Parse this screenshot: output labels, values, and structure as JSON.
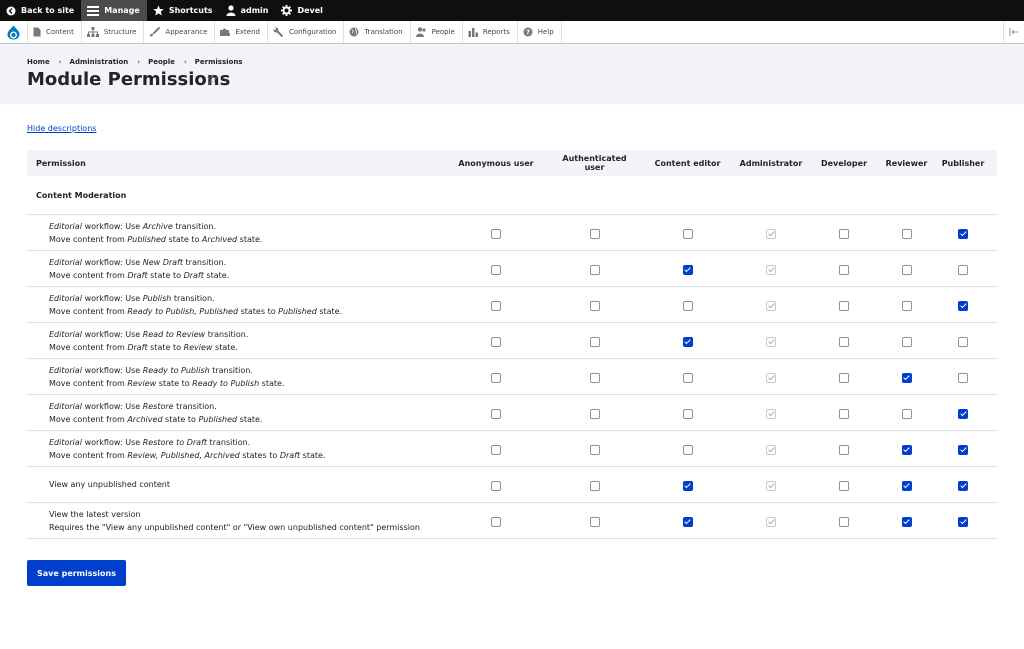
{
  "toolbar": {
    "back": "Back to site",
    "manage": "Manage",
    "shortcuts": "Shortcuts",
    "user": "admin",
    "devel": "Devel"
  },
  "tray": {
    "content": "Content",
    "structure": "Structure",
    "appearance": "Appearance",
    "extend": "Extend",
    "configuration": "Configuration",
    "translation": "Translation",
    "people": "People",
    "reports": "Reports",
    "help": "Help"
  },
  "breadcrumb": [
    "Home",
    "Administration",
    "People",
    "Permissions"
  ],
  "page_title": "Module Permissions",
  "hide_descriptions": "Hide descriptions",
  "columns": [
    "Permission",
    "Anonymous user",
    "Authenticated user",
    "Content editor",
    "Administrator",
    "Developer",
    "Reviewer",
    "Publisher"
  ],
  "group_title": "Content Moderation",
  "permissions": [
    {
      "line1": [
        {
          "t": "Editorial",
          "i": true
        },
        {
          "t": " workflow: Use "
        },
        {
          "t": "Archive",
          "i": true
        },
        {
          "t": " transition."
        }
      ],
      "line2": [
        {
          "t": "Move content from "
        },
        {
          "t": "Published",
          "i": true
        },
        {
          "t": " state to "
        },
        {
          "t": "Archived",
          "i": true
        },
        {
          "t": " state."
        }
      ],
      "checks": [
        0,
        0,
        0,
        2,
        0,
        0,
        1
      ]
    },
    {
      "line1": [
        {
          "t": "Editorial",
          "i": true
        },
        {
          "t": " workflow: Use "
        },
        {
          "t": "New Draft",
          "i": true
        },
        {
          "t": " transition."
        }
      ],
      "line2": [
        {
          "t": "Move content from "
        },
        {
          "t": "Draft",
          "i": true
        },
        {
          "t": " state to "
        },
        {
          "t": "Draft",
          "i": true
        },
        {
          "t": " state."
        }
      ],
      "checks": [
        0,
        0,
        1,
        2,
        0,
        0,
        0
      ]
    },
    {
      "line1": [
        {
          "t": "Editorial",
          "i": true
        },
        {
          "t": " workflow: Use "
        },
        {
          "t": "Publish",
          "i": true
        },
        {
          "t": " transition."
        }
      ],
      "line2": [
        {
          "t": "Move content from "
        },
        {
          "t": "Ready to Publish, Published",
          "i": true
        },
        {
          "t": " states to "
        },
        {
          "t": "Published",
          "i": true
        },
        {
          "t": " state."
        }
      ],
      "checks": [
        0,
        0,
        0,
        2,
        0,
        0,
        1
      ]
    },
    {
      "line1": [
        {
          "t": "Editorial",
          "i": true
        },
        {
          "t": " workflow: Use "
        },
        {
          "t": "Read to Review",
          "i": true
        },
        {
          "t": " transition."
        }
      ],
      "line2": [
        {
          "t": "Move content from "
        },
        {
          "t": "Draft",
          "i": true
        },
        {
          "t": " state to "
        },
        {
          "t": "Review",
          "i": true
        },
        {
          "t": " state."
        }
      ],
      "checks": [
        0,
        0,
        1,
        2,
        0,
        0,
        0
      ]
    },
    {
      "line1": [
        {
          "t": "Editorial",
          "i": true
        },
        {
          "t": " workflow: Use "
        },
        {
          "t": "Ready to Publish",
          "i": true
        },
        {
          "t": " transition."
        }
      ],
      "line2": [
        {
          "t": "Move content from "
        },
        {
          "t": "Review",
          "i": true
        },
        {
          "t": " state to "
        },
        {
          "t": "Ready to Publish",
          "i": true
        },
        {
          "t": " state."
        }
      ],
      "checks": [
        0,
        0,
        0,
        2,
        0,
        1,
        0
      ]
    },
    {
      "line1": [
        {
          "t": "Editorial",
          "i": true
        },
        {
          "t": " workflow: Use "
        },
        {
          "t": "Restore",
          "i": true
        },
        {
          "t": " transition."
        }
      ],
      "line2": [
        {
          "t": "Move content from "
        },
        {
          "t": "Archived",
          "i": true
        },
        {
          "t": " state to "
        },
        {
          "t": "Published",
          "i": true
        },
        {
          "t": " state."
        }
      ],
      "checks": [
        0,
        0,
        0,
        2,
        0,
        0,
        1
      ]
    },
    {
      "line1": [
        {
          "t": "Editorial",
          "i": true
        },
        {
          "t": " workflow: Use "
        },
        {
          "t": "Restore to Draft",
          "i": true
        },
        {
          "t": " transition."
        }
      ],
      "line2": [
        {
          "t": "Move content from "
        },
        {
          "t": "Review, Published, Archived",
          "i": true
        },
        {
          "t": " states to "
        },
        {
          "t": "Draft",
          "i": true
        },
        {
          "t": " state."
        }
      ],
      "checks": [
        0,
        0,
        0,
        2,
        0,
        1,
        1
      ]
    },
    {
      "line1": [
        {
          "t": "View any unpublished content"
        }
      ],
      "line2": [],
      "checks": [
        0,
        0,
        1,
        2,
        0,
        1,
        1
      ]
    },
    {
      "line1": [
        {
          "t": "View the latest version"
        }
      ],
      "line2": [
        {
          "t": "Requires the \"View any unpublished content\" or \"View own unpublished content\" permission"
        }
      ],
      "checks": [
        0,
        0,
        1,
        2,
        0,
        1,
        1
      ]
    }
  ],
  "save_label": "Save permissions"
}
